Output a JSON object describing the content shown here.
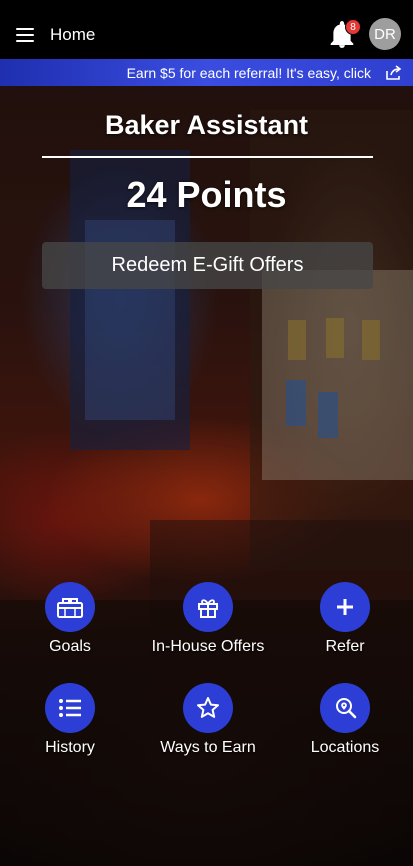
{
  "app_bar": {
    "title": "Home",
    "notification_count": "8",
    "avatar_initials": "DR"
  },
  "banner": {
    "text": "Earn $5 for each referral! It's easy, click"
  },
  "main": {
    "club_name": "Baker Assistant",
    "points": "24 Points",
    "redeem_label": "Redeem E-Gift Offers"
  },
  "actions": [
    {
      "label": "Goals",
      "icon": "gift-card-icon"
    },
    {
      "label": "In-House Offers",
      "icon": "gift-icon"
    },
    {
      "label": "Refer",
      "icon": "plus-icon"
    },
    {
      "label": "History",
      "icon": "list-icon"
    },
    {
      "label": "Ways to Earn",
      "icon": "star-icon"
    },
    {
      "label": "Locations",
      "icon": "map-search-icon"
    }
  ],
  "colors": {
    "accent": "#2c3ed6",
    "banner": "#3a4de0",
    "badge": "#e53935",
    "avatar": "#9e9e9e"
  }
}
